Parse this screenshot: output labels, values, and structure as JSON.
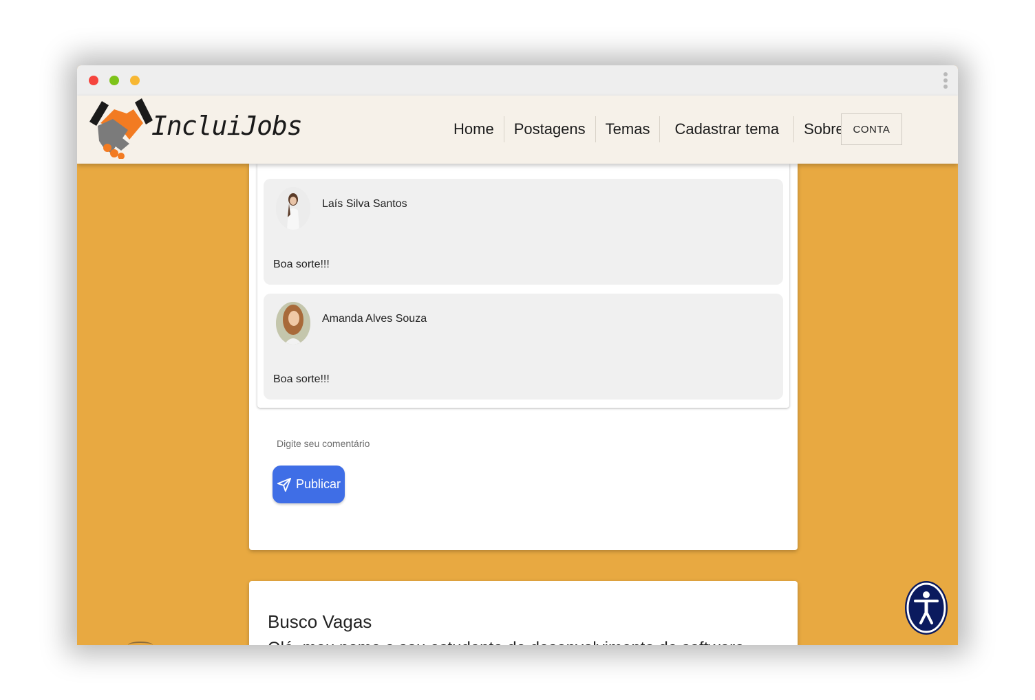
{
  "brand": {
    "name": "IncluiJobs"
  },
  "nav": {
    "links": [
      {
        "label": "Home"
      },
      {
        "label": "Postagens"
      },
      {
        "label": "Temas"
      },
      {
        "label": "Cadastrar tema"
      },
      {
        "label": "Sobre"
      }
    ],
    "account_label": "CONTA"
  },
  "comments": [
    {
      "author": "Laís Silva Santos",
      "text": "Boa sorte!!!"
    },
    {
      "author": "Amanda Alves Souza",
      "text": "Boa sorte!!!"
    }
  ],
  "comment_form": {
    "placeholder": "Digite seu comentário",
    "publish_label": "Publicar"
  },
  "next_post": {
    "title": "Busco Vagas",
    "excerpt": "Olá, meu nome e sou estudante de desenvolvimento de software..."
  },
  "colors": {
    "background": "#e8a941",
    "navbar": "#f6f1e9",
    "publish_button": "#3f6ee6",
    "accessibility_button": "#0b1a5e",
    "logo_orange": "#f27b22"
  },
  "icons": {
    "publish": "send-icon",
    "accessibility": "accessibility-icon",
    "logo": "handshake-icon"
  }
}
